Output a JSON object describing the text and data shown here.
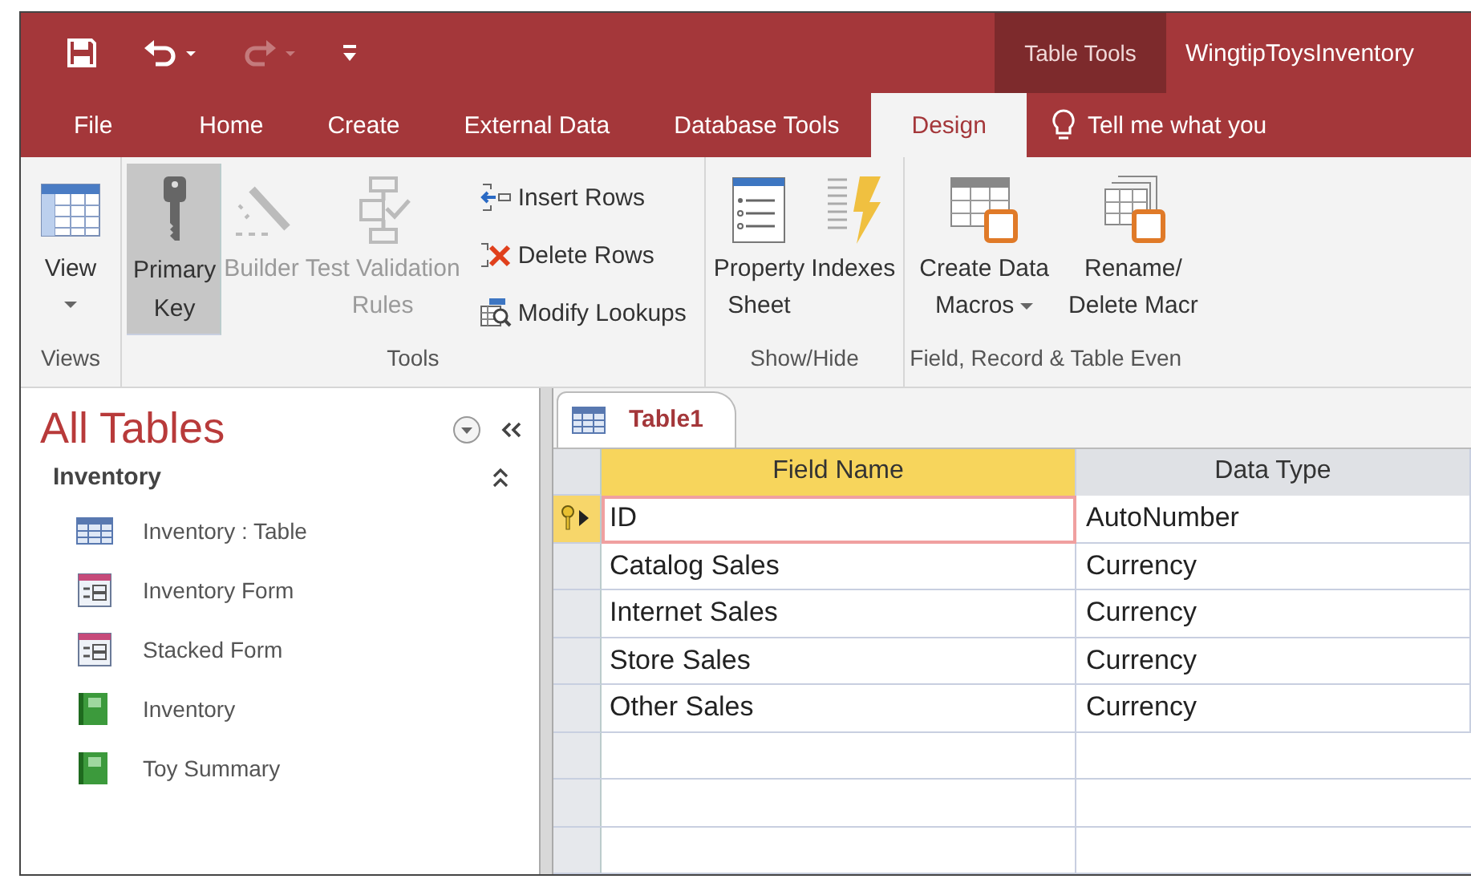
{
  "quick_access": [
    {
      "kind": "save",
      "disabled": false
    },
    {
      "kind": "undo",
      "disabled": false
    },
    {
      "kind": "redo",
      "disabled": true
    },
    {
      "kind": "customize",
      "disabled": false
    }
  ],
  "context_label": "Table Tools",
  "window": {
    "title": "WingtipToysInventory"
  },
  "tabs": [
    {
      "label": "File",
      "selected": false
    },
    {
      "label": "Home",
      "selected": false
    },
    {
      "label": "Create",
      "selected": false
    },
    {
      "label": "External Data",
      "selected": false
    },
    {
      "label": "Database Tools",
      "selected": false
    },
    {
      "label": "Design",
      "selected": true
    }
  ],
  "tell_me": {
    "placeholder": "Tell me what you"
  },
  "ribbon": [
    {
      "label": "Views",
      "buttons": [
        {
          "kind": "view",
          "lines": [
            "View"
          ],
          "dropdown": true,
          "selected": false,
          "disabled": false
        }
      ]
    },
    {
      "label": "Tools",
      "buttons": [
        {
          "kind": "key",
          "lines": [
            "Primary",
            "Key"
          ],
          "dropdown": false,
          "selected": true,
          "disabled": false
        },
        {
          "kind": "builder",
          "lines": [
            "Builder"
          ],
          "dropdown": false,
          "selected": false,
          "disabled": true
        },
        {
          "kind": "validation",
          "lines": [
            "Test Validation",
            "Rules"
          ],
          "dropdown": false,
          "selected": false,
          "disabled": true
        }
      ],
      "small_buttons": [
        {
          "kind": "insert",
          "label": "Insert Rows"
        },
        {
          "kind": "delete",
          "label": "Delete Rows"
        },
        {
          "kind": "lookup",
          "label": "Modify Lookups"
        }
      ]
    },
    {
      "label": "Show/Hide",
      "buttons": [
        {
          "kind": "sheet",
          "lines": [
            "Property",
            "Sheet"
          ],
          "dropdown": false,
          "selected": false,
          "disabled": false
        },
        {
          "kind": "indexes",
          "lines": [
            "Indexes"
          ],
          "dropdown": false,
          "selected": false,
          "disabled": false
        }
      ]
    },
    {
      "label": "Field, Record & Table Even",
      "buttons": [
        {
          "kind": "macro",
          "lines": [
            "Create Data",
            "Macros"
          ],
          "dropdown": true,
          "selected": false,
          "disabled": false
        },
        {
          "kind": "rename",
          "lines": [
            "Rename/",
            "Delete Macr"
          ],
          "dropdown": false,
          "selected": false,
          "disabled": false
        }
      ]
    }
  ],
  "nav": {
    "title": "All Tables",
    "group": {
      "label": "Inventory",
      "expanded": true,
      "items": [
        {
          "kind": "table",
          "label": "Inventory : Table"
        },
        {
          "kind": "form",
          "label": "Inventory Form"
        },
        {
          "kind": "form",
          "label": "Stacked Form"
        },
        {
          "kind": "report",
          "label": "Inventory"
        },
        {
          "kind": "report",
          "label": "Toy Summary"
        }
      ]
    }
  },
  "document_tab": {
    "label": "Table1"
  },
  "table": {
    "columns": [
      {
        "label": "Field Name",
        "selected": true
      },
      {
        "label": "Data Type",
        "selected": false
      }
    ],
    "rows": [
      {
        "field_name": "ID",
        "data_type": "AutoNumber",
        "primary_key": true,
        "selected": true
      },
      {
        "field_name": "Catalog Sales",
        "data_type": "Currency",
        "primary_key": false,
        "selected": false
      },
      {
        "field_name": "Internet Sales",
        "data_type": "Currency",
        "primary_key": false,
        "selected": false
      },
      {
        "field_name": "Store Sales",
        "data_type": "Currency",
        "primary_key": false,
        "selected": false
      },
      {
        "field_name": "Other Sales",
        "data_type": "Currency",
        "primary_key": false,
        "selected": false
      }
    ]
  }
}
